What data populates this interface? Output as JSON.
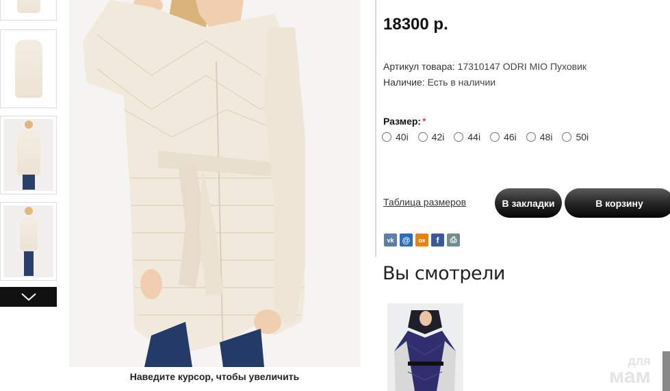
{
  "product": {
    "price": "18300 р.",
    "sku_label": "Артикул товара:",
    "sku_value": "17310147 ODRI MIO Пуховик",
    "availability_label": "Наличие:",
    "availability_value": "Есть в наличии",
    "size_label": "Размер:",
    "size_required_mark": "*",
    "sizes": [
      "40i",
      "42i",
      "44i",
      "46i",
      "48i",
      "50i"
    ],
    "size_table_link": "Таблица размеров",
    "bookmark_button": "В закладки",
    "cart_button": "В корзину"
  },
  "gallery": {
    "zoom_hint": "Наведите курсор, чтобы увеличить"
  },
  "share": {
    "icons": [
      "vk-icon",
      "mail-icon",
      "odnoklassniki-icon",
      "facebook-icon",
      "print-icon"
    ],
    "glyphs": [
      "vk",
      "@",
      "ок",
      "f",
      "⎙"
    ],
    "colors": [
      "#5b7fa6",
      "#2a6ebb",
      "#ee8208",
      "#3b5998",
      "#6f8f8f"
    ]
  },
  "recent": {
    "title": "Вы смотрели"
  },
  "watermark": {
    "top": "для",
    "bottom": "мам"
  }
}
